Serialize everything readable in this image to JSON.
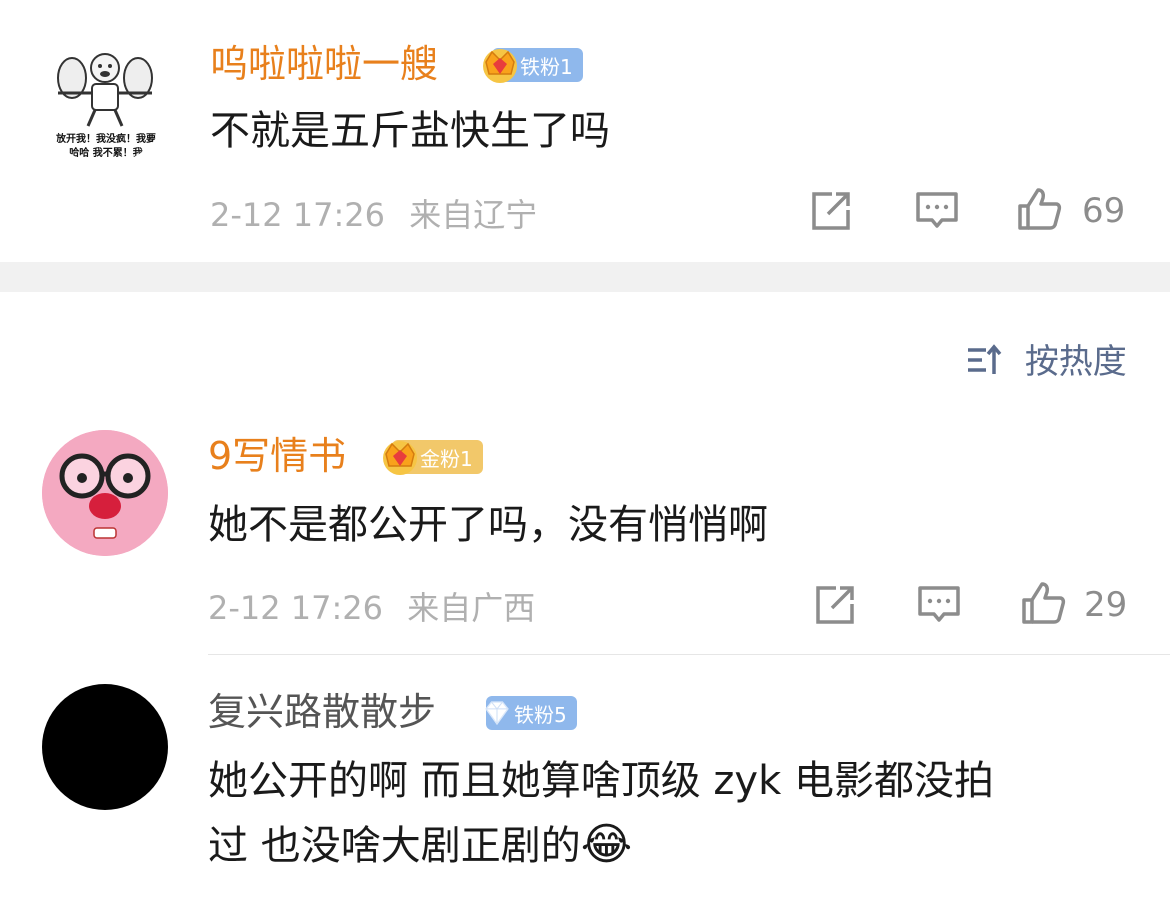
{
  "comments": [
    {
      "username": "呜啦啦啦一艘",
      "badge": "铁粉1",
      "text": "不就是五斤盐快生了吗",
      "time": "2-12 17:26",
      "location": "来自辽宁",
      "likes": "69",
      "avatar_caption_1": "放开我！我没疯！我要",
      "avatar_caption_2": "哈哈 我不累！我"
    },
    {
      "username": "9写情书",
      "badge": "金粉1",
      "text": "她不是都公开了吗，没有悄悄啊",
      "time": "2-12 17:26",
      "location": "来自广西",
      "likes": "29"
    },
    {
      "username": "复兴路散散步",
      "badge": "铁粉5",
      "text_line1": "她公开的啊 而且她算啥顶级 zyk 电影都没拍",
      "text_line2": "过 也没啥大剧正剧的",
      "emoji": "😂"
    }
  ],
  "sort": {
    "label": "按热度"
  },
  "colors": {
    "username_highlight": "#e8801c",
    "username_plain": "#555555",
    "badge_iron": "#8fb8ec",
    "badge_gold": "#f2c86a",
    "meta_gray": "#b0b0b0",
    "sort_blue": "#5a6b8c"
  },
  "icons": {
    "share": "share-icon",
    "comment": "comment-icon",
    "like": "thumbs-up-icon",
    "sort": "sort-icon",
    "crown": "crown-icon",
    "diamond": "diamond-icon"
  }
}
